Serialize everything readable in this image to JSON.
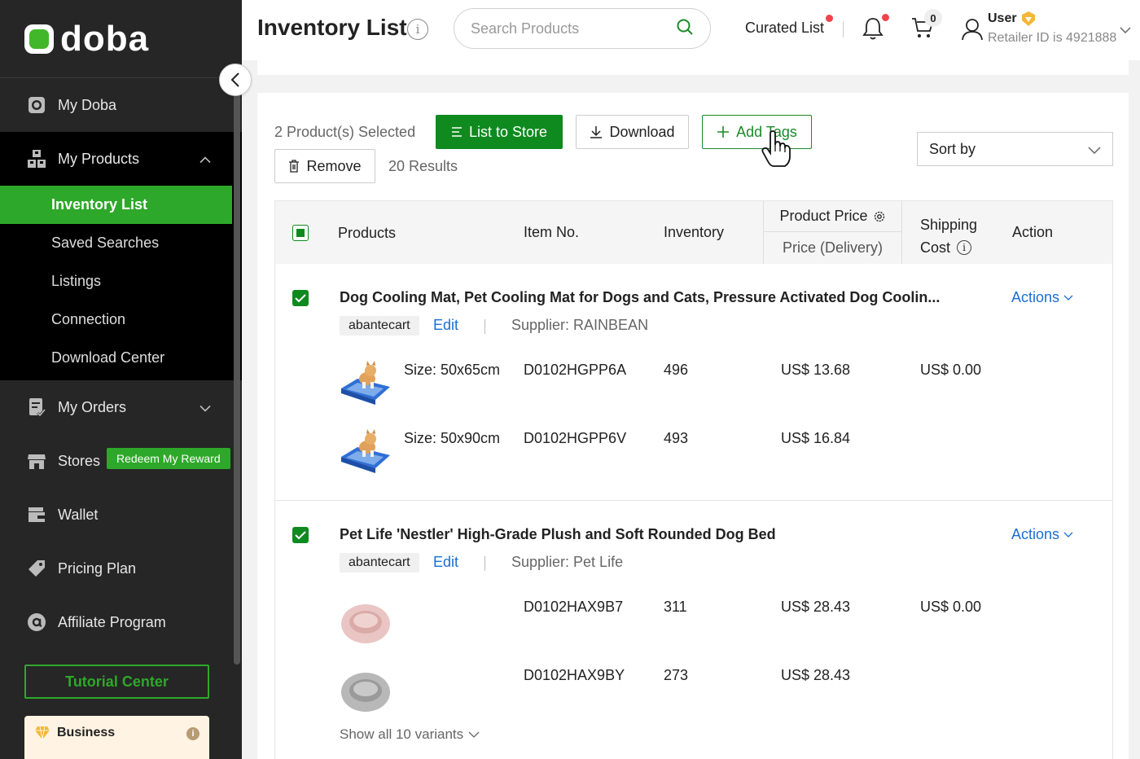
{
  "brand": {
    "name": "doba"
  },
  "sidebar": {
    "items": [
      {
        "label": "My Doba",
        "icon": "camera-icon"
      },
      {
        "label": "My Products",
        "icon": "products-icon"
      },
      {
        "label": "My Orders",
        "icon": "orders-icon"
      },
      {
        "label": "Stores",
        "icon": "store-icon"
      },
      {
        "label": "Wallet",
        "icon": "wallet-icon"
      },
      {
        "label": "Pricing Plan",
        "icon": "tag-icon"
      },
      {
        "label": "Affiliate Program",
        "icon": "affiliate-icon"
      }
    ],
    "subitems": [
      "Inventory List",
      "Saved Searches",
      "Listings",
      "Connection",
      "Download Center"
    ],
    "reward_label": "Redeem My Reward",
    "tutorial_label": "Tutorial Center",
    "business_label": "Business"
  },
  "header": {
    "title": "Inventory List",
    "search_placeholder": "Search Products",
    "curated_label": "Curated List",
    "cart_count": "0",
    "user_name": "User",
    "retailer_text": "Retailer ID is 4921888"
  },
  "toolbar": {
    "selected_text": "2 Product(s) Selected",
    "list_to_store": "List to Store",
    "download": "Download",
    "add_tags": "Add Tags",
    "remove": "Remove",
    "results": "20 Results",
    "sort_by": "Sort by"
  },
  "table": {
    "headers": {
      "products": "Products",
      "item_no": "Item No.",
      "inventory": "Inventory",
      "product_price": "Product Price",
      "price_delivery": "Price (Delivery)",
      "shipping_line1": "Shipping",
      "shipping_line2": "Cost",
      "action": "Action"
    },
    "products": [
      {
        "title": "Dog Cooling Mat, Pet Cooling Mat for Dogs and Cats, Pressure Activated Dog Coolin...",
        "store": "abantecart",
        "edit": "Edit",
        "supplier": "Supplier: RAINBEAN",
        "actions": "Actions",
        "variants": [
          {
            "name": "Size: 50x65cm",
            "item": "D0102HGPP6A",
            "inventory": "496",
            "price": "US$ 13.68",
            "shipping": "US$ 0.00"
          },
          {
            "name": "Size: 50x90cm",
            "item": "D0102HGPP6V",
            "inventory": "493",
            "price": "US$ 16.84",
            "shipping": ""
          }
        ]
      },
      {
        "title": "Pet Life 'Nestler' High-Grade Plush and Soft Rounded Dog Bed",
        "store": "abantecart",
        "edit": "Edit",
        "supplier": "Supplier: Pet Life",
        "actions": "Actions",
        "variants": [
          {
            "name": "",
            "item": "D0102HAX9B7",
            "inventory": "311",
            "price": "US$ 28.43",
            "shipping": "US$ 0.00"
          },
          {
            "name": "",
            "item": "D0102HAX9BY",
            "inventory": "273",
            "price": "US$ 28.43",
            "shipping": ""
          }
        ],
        "show_all": "Show all 10 variants"
      }
    ]
  },
  "colors": {
    "brand_green": "#0f8a1f",
    "link_blue": "#1a6fd1",
    "sidebar_bg": "#262626"
  }
}
